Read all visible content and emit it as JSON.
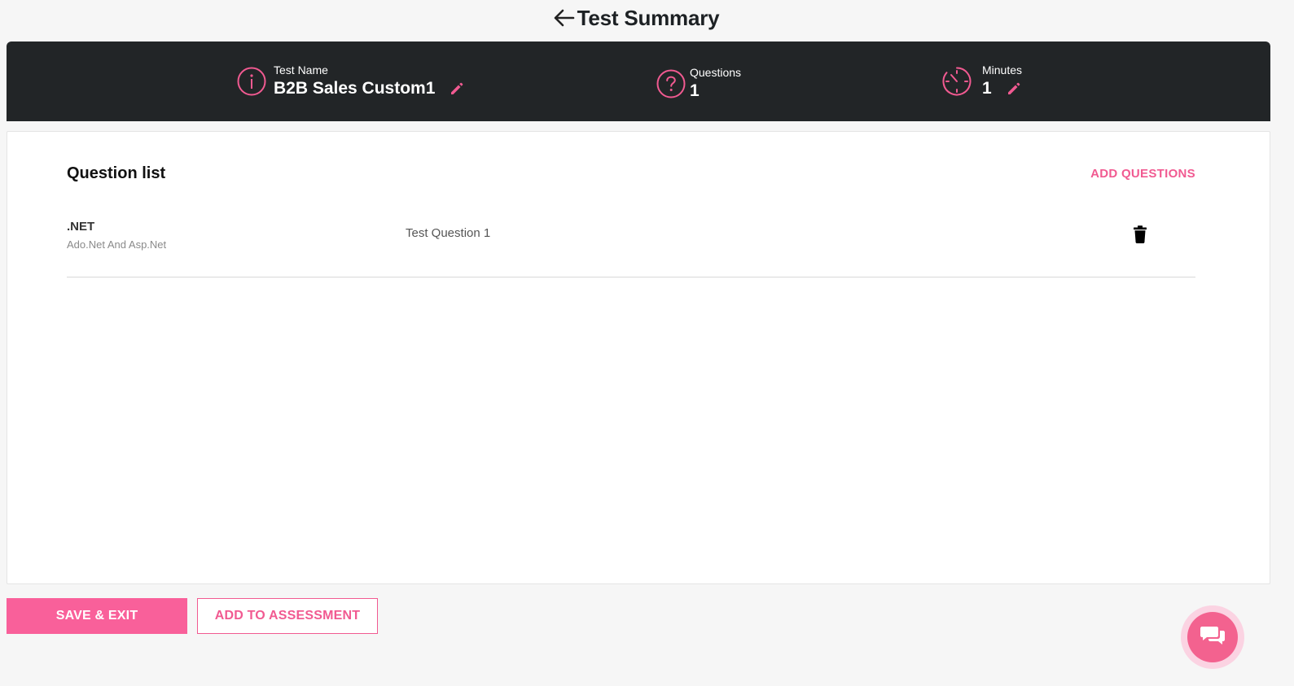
{
  "header": {
    "title": "Test Summary"
  },
  "summary": {
    "test_name_label": "Test Name",
    "test_name_value": "B2B Sales Custom1",
    "questions_label": "Questions",
    "questions_value": "1",
    "minutes_label": "Minutes",
    "minutes_value": "1"
  },
  "question_list": {
    "title": "Question list",
    "add_label": "ADD QUESTIONS",
    "rows": [
      {
        "subject": ".NET",
        "topic": "Ado.Net And Asp.Net",
        "question": "Test Question 1"
      }
    ]
  },
  "actions": {
    "save_exit_label": "SAVE & EXIT",
    "add_assessment_label": "ADD TO ASSESSMENT"
  },
  "colors": {
    "accent": "#f15a91",
    "bar": "#222527"
  }
}
